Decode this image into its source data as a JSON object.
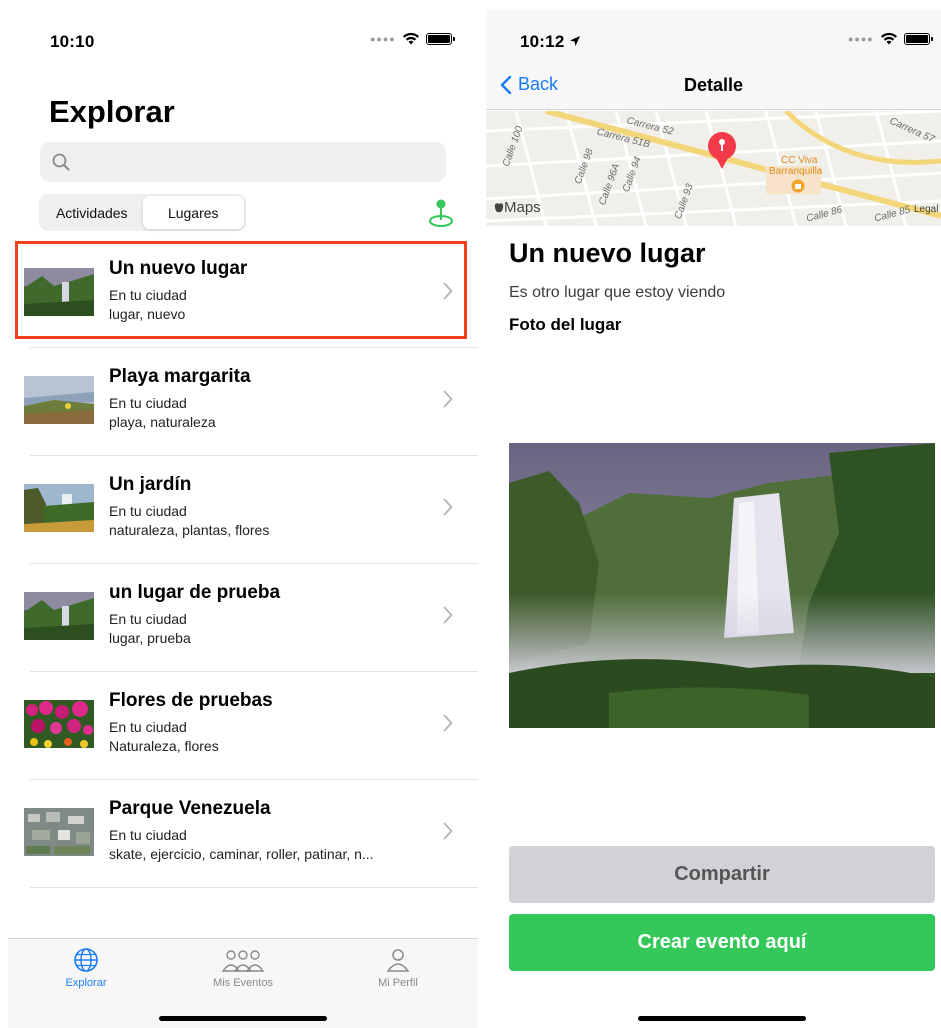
{
  "left_screen": {
    "status_bar": {
      "time": "10:10"
    },
    "title": "Explorar",
    "search": {
      "placeholder": "",
      "value": ""
    },
    "segments": [
      {
        "label": "Actividades",
        "selected": false
      },
      {
        "label": "Lugares",
        "selected": true
      }
    ],
    "places": [
      {
        "title": "Un nuevo lugar",
        "subtitle": "En tu ciudad",
        "tags": "lugar, nuevo",
        "thumb": "waterfall"
      },
      {
        "title": "Playa margarita",
        "subtitle": "En tu ciudad",
        "tags": "playa, naturaleza",
        "thumb": "coast"
      },
      {
        "title": "Un jardín",
        "subtitle": "En tu ciudad",
        "tags": "naturaleza, plantas, flores",
        "thumb": "cliff"
      },
      {
        "title": "un lugar de prueba",
        "subtitle": "En tu ciudad",
        "tags": "lugar, prueba",
        "thumb": "waterfall"
      },
      {
        "title": "Flores de pruebas",
        "subtitle": "En tu ciudad",
        "tags": "Naturaleza, flores",
        "thumb": "flowers"
      },
      {
        "title": "Parque Venezuela",
        "subtitle": "En tu ciudad",
        "tags": "skate, ejercicio, caminar, roller, patinar, n...",
        "thumb": "aerial"
      }
    ],
    "tab_bar": [
      {
        "label": "Explorar",
        "icon": "globe-icon",
        "active": true
      },
      {
        "label": "Mis Eventos",
        "icon": "people-icon",
        "active": false
      },
      {
        "label": "Mi Perfil",
        "icon": "person-icon",
        "active": false
      }
    ]
  },
  "right_screen": {
    "status_bar": {
      "time": "10:12"
    },
    "nav": {
      "back_label": "Back",
      "title": "Detalle"
    },
    "map": {
      "labels": [
        "Carrera 51B",
        "Carrera 52",
        "Calle 100",
        "Calle 98",
        "Calle 96A",
        "Calle 94",
        "Calle 93",
        "Carrera 57",
        "Calle 86",
        "Calle 85",
        "CC Viva",
        "Barranquilla",
        "Maps",
        "Legal"
      ],
      "attribution": "Maps",
      "legal": "Legal"
    },
    "place_title": "Un nuevo lugar",
    "place_description": "Es otro lugar que estoy viendo",
    "photo_label": "Foto del lugar",
    "buttons": {
      "share": "Compartir",
      "create_event": "Crear evento aquí"
    }
  },
  "colors": {
    "accent_blue": "#1a7cf5",
    "green": "#34c759",
    "highlight_red": "#f2401c",
    "share_button_gray": "#d1d1d6"
  }
}
